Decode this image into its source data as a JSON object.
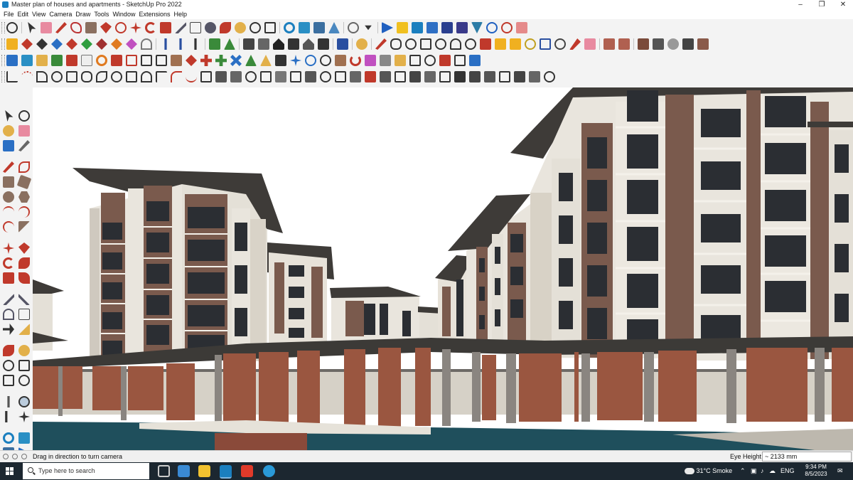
{
  "window": {
    "title": "Master plan of houses and apartments - SketchUp Pro 2022"
  },
  "menu": [
    "File",
    "Edit",
    "View",
    "Camera",
    "Draw",
    "Tools",
    "Window",
    "Extensions",
    "Help"
  ],
  "status": {
    "hint": "Drag in direction to turn camera",
    "measure_label": "Eye Height",
    "measure_value": "~ 2133 mm"
  },
  "taskbar": {
    "search_placeholder": "Type here to search",
    "weather": "31°C  Smoke",
    "language": "ENG",
    "time": "9:34 PM",
    "date": "8/5/2023"
  },
  "colors": {
    "accent": "#1b7fbf",
    "sky": "#ffffff",
    "facade_light": "#e9e5dd",
    "facade_brown": "#7a5a4d",
    "roof": "#3e3b38",
    "water": "#1f4f5c",
    "pergola_wood": "#9a5640",
    "taskbar": "#1c2730"
  }
}
